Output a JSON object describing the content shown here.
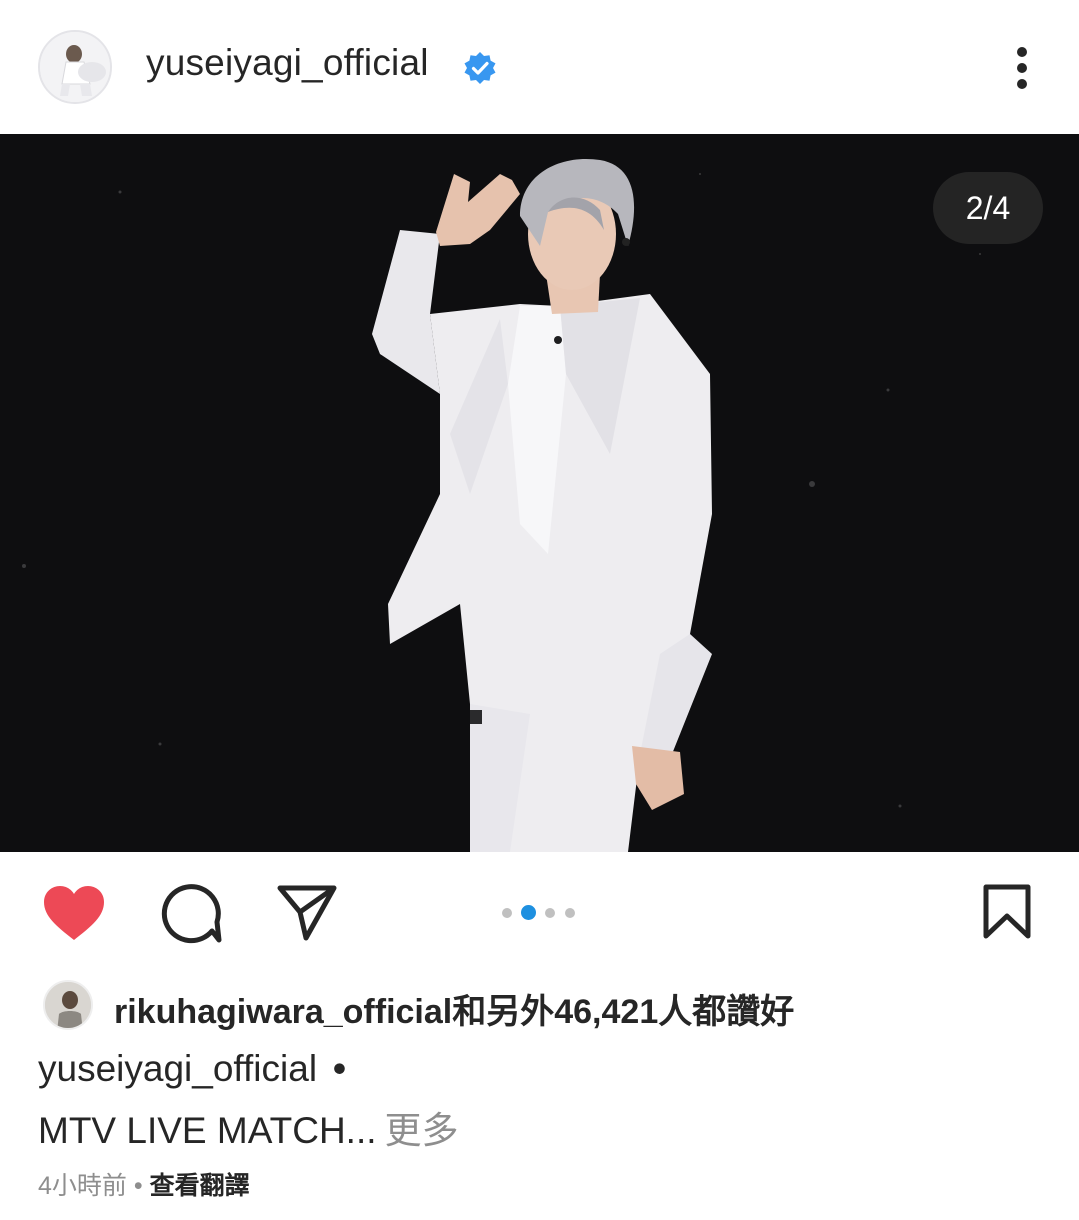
{
  "post": {
    "username": "yuseiyagi_official",
    "image_counter": "2/4",
    "carousel": {
      "count": 4,
      "active_index": 1
    }
  },
  "icons": {
    "verified": "verified-badge-icon",
    "more": "more-vertical-icon",
    "like": "heart-filled-icon",
    "comment": "comment-icon",
    "share": "paper-plane-icon",
    "save": "bookmark-icon"
  },
  "colors": {
    "like": "#ed4956",
    "verified": "#3897f0",
    "active_dot": "#1e90e0"
  },
  "likes": {
    "liker": "rikuhagiwara_official",
    "connector": "和另外",
    "count": "46,421",
    "suffix": "人都讚好"
  },
  "caption": {
    "username": "yuseiyagi_official",
    "separator": "•",
    "text": "MTV LIVE MATCH...",
    "more_label": "更多"
  },
  "meta": {
    "time": "4小時前",
    "separator": "•",
    "translate_label": "查看翻譯"
  }
}
